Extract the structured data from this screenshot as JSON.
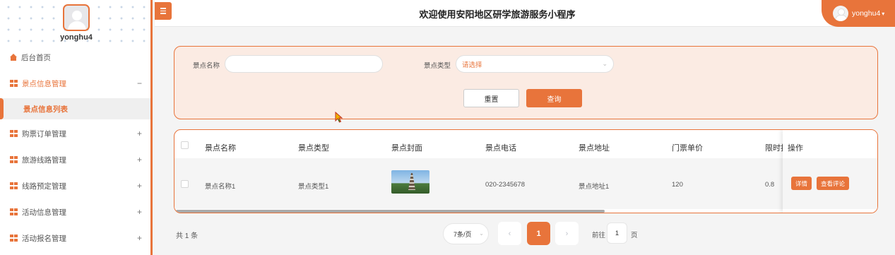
{
  "sidebar": {
    "username": "yonghu4",
    "items": [
      {
        "label": "后台首页",
        "icon": "home-icon",
        "toggle": ""
      },
      {
        "label": "景点信息管理",
        "icon": "grid-icon",
        "toggle": "−"
      },
      {
        "label": "购票订单管理",
        "icon": "grid-icon",
        "toggle": "+"
      },
      {
        "label": "旅游线路管理",
        "icon": "grid-icon",
        "toggle": "+"
      },
      {
        "label": "线路预定管理",
        "icon": "grid-icon",
        "toggle": "+"
      },
      {
        "label": "活动信息管理",
        "icon": "grid-icon",
        "toggle": "+"
      },
      {
        "label": "活动报名管理",
        "icon": "grid-icon",
        "toggle": "+"
      }
    ],
    "submenu_active": "景点信息列表"
  },
  "header": {
    "title": "欢迎使用安阳地区研学旅游服务小程序",
    "user": "yonghu4"
  },
  "search": {
    "name_label": "景点名称",
    "name_value": "",
    "type_label": "景点类型",
    "type_placeholder": "请选择",
    "reset_label": "重置",
    "query_label": "查询"
  },
  "table": {
    "columns": [
      "景点名称",
      "景点类型",
      "景点封面",
      "景点电话",
      "景点地址",
      "门票单价",
      "限时打",
      "操作"
    ],
    "rows": [
      {
        "name": "景点名称1",
        "type": "景点类型1",
        "cover": "pagoda-photo",
        "phone": "020-2345678",
        "address": "景点地址1",
        "price": "120",
        "discount": "0.8",
        "actions": [
          "详情",
          "查看评论"
        ]
      }
    ]
  },
  "pagination": {
    "total": "共 1 条",
    "page_size": "7条/页",
    "prev": "‹",
    "current": "1",
    "next": "›",
    "goto_prefix": "前往",
    "goto_value": "1",
    "goto_suffix": "页"
  },
  "colors": {
    "accent": "#e8743b",
    "panel_bg": "#fbebe3"
  }
}
